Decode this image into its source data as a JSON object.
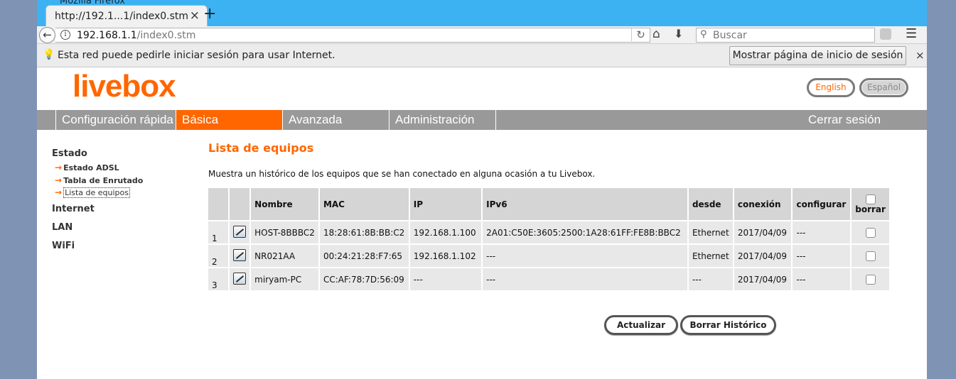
{
  "browser": {
    "window_title": "Mozilla Firefox",
    "tab_title": "http://192.1...1/index0.stm",
    "new_tab": "+",
    "tab_close": "×",
    "url_host": "192.168.1.1",
    "url_path": "/index0.stm",
    "search_placeholder": "Buscar"
  },
  "notification": {
    "text": "Esta red puede pedirle iniciar sesión para usar Internet.",
    "button": "Mostrar página de inicio de sesión",
    "close": "×"
  },
  "header": {
    "logo": "livebox",
    "lang_en": "English",
    "lang_es": "Español"
  },
  "menu": {
    "items": [
      "Configuración rápida",
      "Básica",
      "Avanzada",
      "Administración"
    ],
    "active_index": 1,
    "logout": "Cerrar sesión"
  },
  "sidebar": {
    "sections": [
      "Estado",
      "Internet",
      "LAN",
      "WiFi"
    ],
    "subitems": [
      "Estado ADSL",
      "Tabla de Enrutado",
      "Lista de equipos"
    ]
  },
  "main": {
    "title": "Lista de equipos",
    "description": "Muestra un histórico de los equipos que se han conectado en alguna ocasión a tu Livebox.",
    "columns": [
      "",
      "",
      "Nombre",
      "MAC",
      "IP",
      "IPv6",
      "desde",
      "conexión",
      "configurar",
      "borrar"
    ],
    "rows": [
      {
        "n": "1",
        "nombre": "HOST-8BBBC2",
        "mac": "18:28:61:8B:BB:C2",
        "ip": "192.168.1.100",
        "ipv6": "2A01:C50E:3605:2500:1A28:61FF:FE8B:BBC2",
        "desde": "Ethernet",
        "conexion": "2017/04/09",
        "configurar": "---"
      },
      {
        "n": "2",
        "nombre": "NR021AA",
        "mac": "00:24:21:28:F7:65",
        "ip": "192.168.1.102",
        "ipv6": "---",
        "desde": "Ethernet",
        "conexion": "2017/04/09",
        "configurar": "---"
      },
      {
        "n": "3",
        "nombre": "miryam-PC",
        "mac": "CC:AF:78:7D:56:09",
        "ip": "---",
        "ipv6": "---",
        "desde": "---",
        "conexion": "2017/04/09",
        "configurar": "---"
      }
    ],
    "btn_refresh": "Actualizar",
    "btn_clear": "Borrar Histórico"
  },
  "colors": {
    "accent": "#ff6600",
    "menu_bg": "#999999",
    "tabstrip": "#3db2f3"
  }
}
